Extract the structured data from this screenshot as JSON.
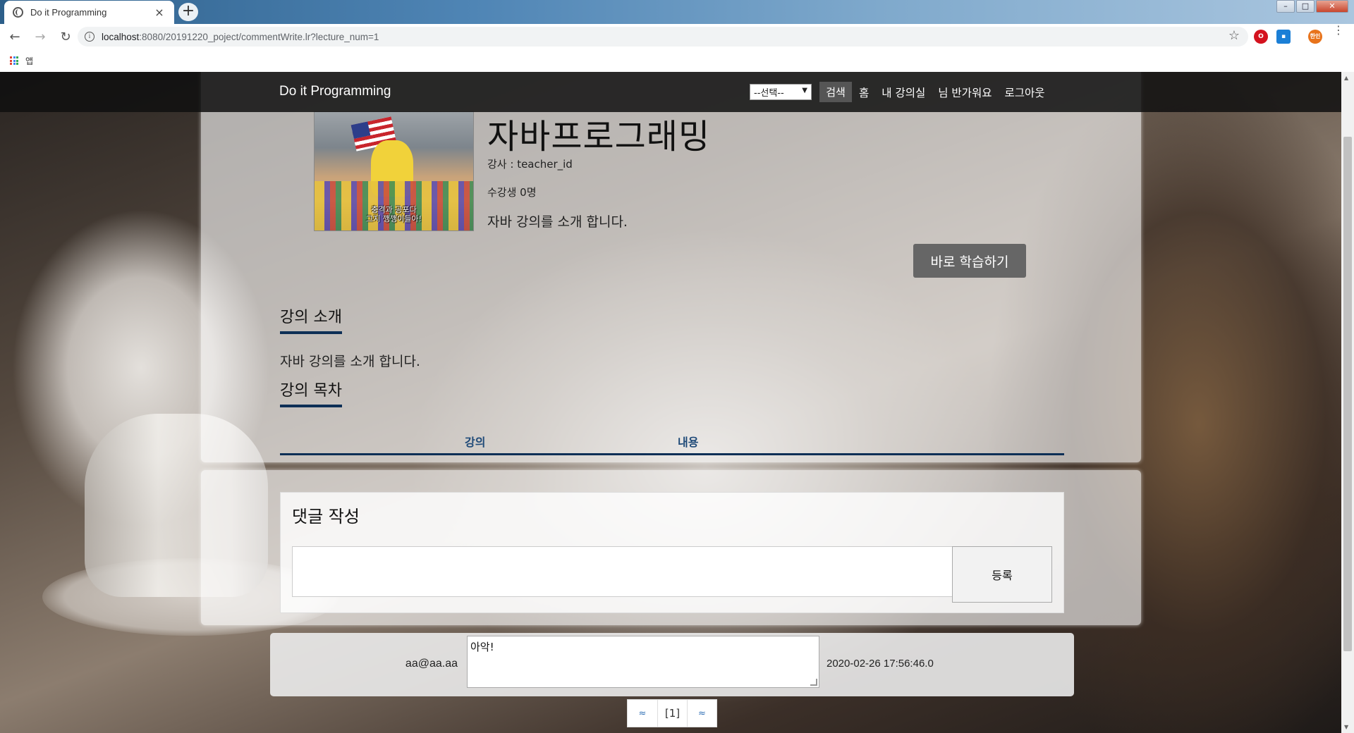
{
  "browser": {
    "tab_title": "Do it Programming",
    "tab_close": "×",
    "new_tab": "+",
    "url_host": "localhost",
    "url_path": ":8080/20191220_poject/commentWrite.lr?lecture_num=1",
    "bookmarks_label": "앱",
    "profile_label": "한인"
  },
  "nav": {
    "brand": "Do it Programming",
    "select_value": "--선택--",
    "search_button": "검색",
    "links": [
      "홈",
      "내 강의실",
      "님 반가워요",
      "로그아웃"
    ]
  },
  "course": {
    "image_subtitle_line1": "충격과 공포다",
    "image_subtitle_line2": "그지 깽깽이들아!",
    "title": "자바프로그래밍",
    "teacher": "강사 : teacher_id",
    "students": "수강생 0명",
    "intro_short": "자바 강의를 소개 합니다.",
    "learn_button": "바로 학습하기",
    "intro_heading": "강의 소개",
    "intro_text": "자바 강의를 소개 합니다.",
    "toc_heading": "강의 목차",
    "toc_columns": [
      "강의",
      "내용"
    ]
  },
  "comment_form": {
    "heading": "댓글 작성",
    "input_value": "",
    "submit_button": "등록"
  },
  "comments": [
    {
      "author": "aa@aa.aa",
      "content": "아악!",
      "date": "2020-02-26 17:56:46.0"
    }
  ],
  "pagination": {
    "prev": "≈",
    "current": "[1]",
    "next": "≈"
  }
}
